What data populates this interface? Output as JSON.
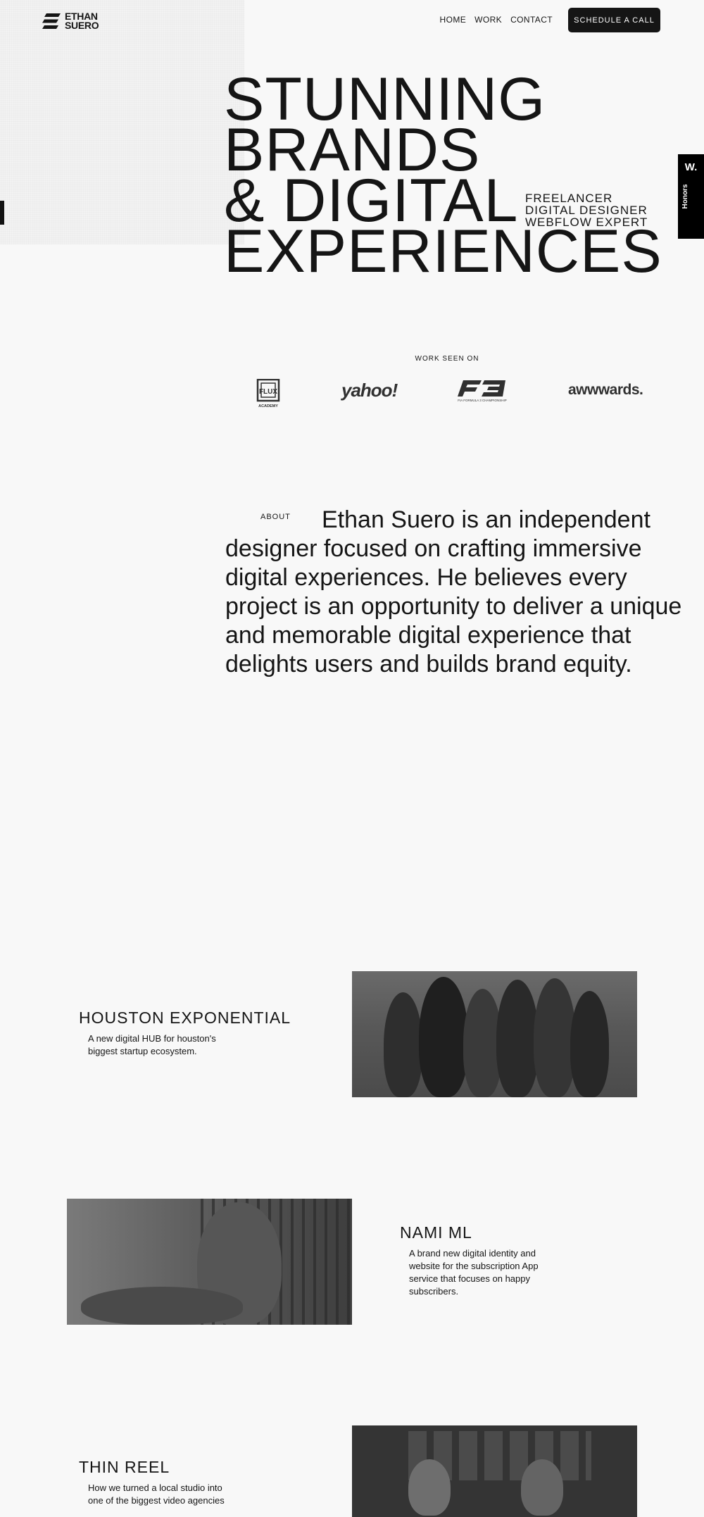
{
  "header": {
    "logo_line1": "ETHAN",
    "logo_line2": "SUERO",
    "nav": [
      "HOME",
      "WORK",
      "CONTACT"
    ],
    "cta": "SCHEDULE A CALL"
  },
  "hero": {
    "lines": [
      "STUNNING",
      "BRANDS",
      "& DIGITAL",
      "EXPERIENCES"
    ],
    "roles": [
      "FREELANCER",
      "DIGITAL DESIGNER",
      "WEBFLOW EXPERT"
    ]
  },
  "honors": {
    "mark": "W.",
    "label": "Honors"
  },
  "seen_on": {
    "label": "WORK SEEN ON",
    "flux_caption": "ACADEMY",
    "yahoo": "yahoo!",
    "f3_caption": "FIA FORMULA 3 CHAMPIONSHIP",
    "awwwards": "awwwards."
  },
  "about": {
    "label": "ABOUT",
    "text": "Ethan Suero is an independent designer focused on crafting immersive digital experiences. He believes every project is an opportunity to deliver a unique and memorable digital experience that delights users and builds brand equity."
  },
  "projects": [
    {
      "title": "HOUSTON EXPONENTIAL",
      "desc": "A new digital HUB for houston's biggest startup ecosystem."
    },
    {
      "title": "NAMI ML",
      "desc": "A brand new digital identity and website for the subscription App service that focuses on happy subscribers."
    },
    {
      "title": "THIN REEL",
      "desc": "How we turned a local studio into one of the biggest video agencies"
    }
  ]
}
